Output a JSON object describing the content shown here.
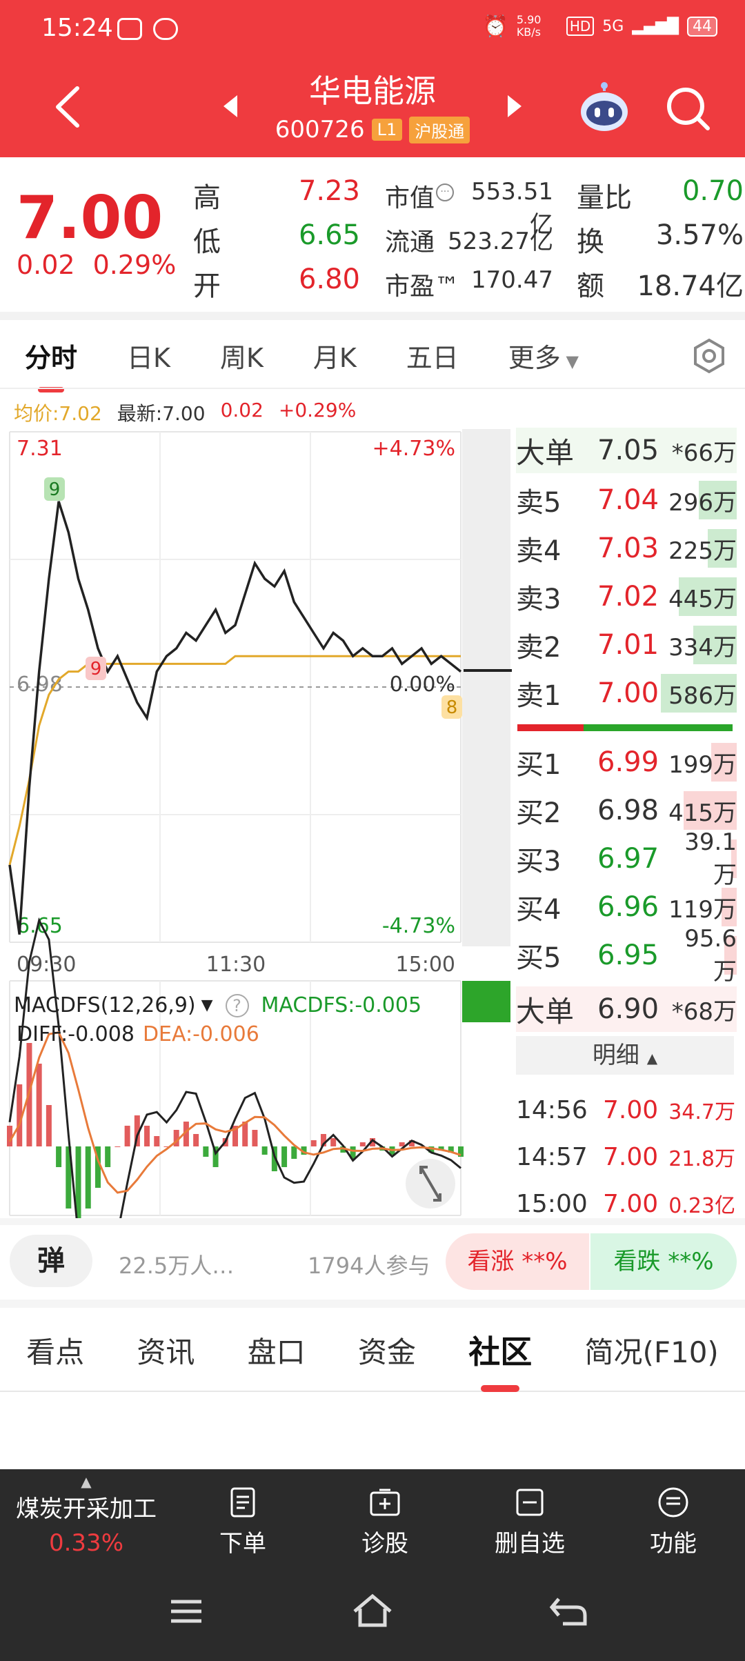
{
  "status": {
    "time": "15:24",
    "net_speed": "5.90 KB/s",
    "hd": "HD",
    "signal": "5G",
    "battery": "44"
  },
  "header": {
    "name": "华电能源",
    "code": "600726",
    "level": "L1",
    "connect": "沪股通"
  },
  "quote": {
    "price": "7.00",
    "change": "0.02",
    "change_pct": "0.29%",
    "high_label": "高",
    "high": "7.23",
    "low_label": "低",
    "low": "6.65",
    "open_label": "开",
    "open": "6.80",
    "mktcap_label": "市值",
    "mktcap": "553.51亿",
    "float_label": "流通",
    "float": "523.27亿",
    "pe_label": "市盈™",
    "pe": "170.47",
    "vr_label": "量比",
    "vr": "0.70",
    "turn_label": "换",
    "turn": "3.57%",
    "amount_label": "额",
    "amount": "18.74亿"
  },
  "tabs": [
    "分时",
    "日K",
    "周K",
    "月K",
    "五日",
    "更多"
  ],
  "summary": {
    "avg": "均价:7.02",
    "latest": "最新:7.00",
    "chg": "0.02",
    "pct": "+0.29%"
  },
  "chart_data": {
    "type": "line",
    "x_ticks": [
      "09:30",
      "11:30",
      "15:00"
    ],
    "y_top": "7.31",
    "y_bottom": "6.65",
    "y_ref": "6.98",
    "pct_top": "+4.73%",
    "pct_mid": "0.00%",
    "pct_bottom": "-4.73%",
    "ylim": [
      6.65,
      7.31
    ],
    "badges": [
      "9",
      "9",
      "8"
    ],
    "price": [
      6.75,
      6.66,
      6.85,
      7.0,
      7.12,
      7.22,
      7.18,
      7.12,
      7.08,
      7.03,
      7.0,
      7.02,
      6.99,
      6.96,
      6.94,
      7.0,
      7.02,
      7.03,
      7.05,
      7.04,
      7.06,
      7.08,
      7.05,
      7.06,
      7.1,
      7.14,
      7.12,
      7.11,
      7.13,
      7.09,
      7.07,
      7.05,
      7.03,
      7.05,
      7.04,
      7.02,
      7.03,
      7.02,
      7.02,
      7.03,
      7.01,
      7.02,
      7.03,
      7.01,
      7.02,
      7.01,
      7.0
    ],
    "avg_line": [
      6.75,
      6.8,
      6.86,
      6.93,
      6.97,
      6.99,
      7.0,
      7.0,
      7.01,
      7.01,
      7.01,
      7.01,
      7.01,
      7.01,
      7.01,
      7.01,
      7.01,
      7.01,
      7.01,
      7.01,
      7.01,
      7.01,
      7.01,
      7.02,
      7.02,
      7.02,
      7.02,
      7.02,
      7.02,
      7.02,
      7.02,
      7.02,
      7.02,
      7.02,
      7.02,
      7.02,
      7.02,
      7.02,
      7.02,
      7.02,
      7.02,
      7.02,
      7.02,
      7.02,
      7.02,
      7.02,
      7.02
    ]
  },
  "macd": {
    "title": "MACDFS(12,26,9)",
    "value": "MACDFS:-0.005",
    "diff": "DIFF:-0.008",
    "dea": "DEA:-0.006",
    "hist": [
      0.01,
      0.03,
      0.05,
      0.04,
      0.02,
      -0.01,
      -0.03,
      -0.04,
      -0.03,
      -0.02,
      -0.01,
      0.0,
      0.01,
      0.015,
      0.01,
      0.005,
      0.0,
      0.008,
      0.012,
      0.006,
      -0.005,
      -0.01,
      0.004,
      0.01,
      0.012,
      0.008,
      -0.004,
      -0.012,
      -0.01,
      -0.006,
      -0.004,
      0.003,
      0.006,
      0.004,
      -0.003,
      -0.006,
      0.002,
      0.004,
      -0.002,
      -0.004,
      0.002,
      0.003,
      -0.001,
      -0.003,
      -0.002,
      -0.003,
      -0.005
    ]
  },
  "orderbook": {
    "big_top_label": "大单",
    "big_top_price": "7.05",
    "big_top_vol": "*66万",
    "asks": [
      {
        "label": "卖5",
        "price": "7.04",
        "vol": "296万",
        "bar": 0.5
      },
      {
        "label": "卖4",
        "price": "7.03",
        "vol": "225万",
        "bar": 0.38
      },
      {
        "label": "卖3",
        "price": "7.02",
        "vol": "445万",
        "bar": 0.76
      },
      {
        "label": "卖2",
        "price": "7.01",
        "vol": "334万",
        "bar": 0.57
      },
      {
        "label": "卖1",
        "price": "7.00",
        "vol": "586万",
        "bar": 1.0
      }
    ],
    "bids": [
      {
        "label": "买1",
        "price": "6.99",
        "vol": "199万",
        "bar": 0.34
      },
      {
        "label": "买2",
        "price": "6.98",
        "vol": "415万",
        "bar": 0.7
      },
      {
        "label": "买3",
        "price": "6.97",
        "vol": "39.1万",
        "bar": 0.07
      },
      {
        "label": "买4",
        "price": "6.96",
        "vol": "119万",
        "bar": 0.2
      },
      {
        "label": "买5",
        "price": "6.95",
        "vol": "95.6万",
        "bar": 0.16
      }
    ],
    "big_bottom_label": "大单",
    "big_bottom_price": "6.90",
    "big_bottom_vol": "*68万",
    "detail_label": "明细",
    "trades": [
      {
        "time": "14:56",
        "price": "7.00",
        "vol": "34.7万"
      },
      {
        "time": "14:57",
        "price": "7.00",
        "vol": "21.8万"
      },
      {
        "time": "15:00",
        "price": "7.00",
        "vol": "0.23亿"
      }
    ]
  },
  "social": {
    "dan": "弹",
    "watchers": "22.5万人…",
    "participants": "1794人参与",
    "up": "看涨 **%",
    "down": "看跌 **%"
  },
  "info_tabs": [
    "看点",
    "资讯",
    "盘口",
    "资金",
    "社区",
    "简况(F10)"
  ],
  "toolbar": {
    "sector": "煤炭开采加工",
    "sector_pct": "0.33%",
    "order": "下单",
    "diagnose": "诊股",
    "remove": "删自选",
    "func": "功能"
  },
  "colors": {
    "red": "#e3242b",
    "green": "#1a9a2a",
    "header": "#ef3b3f",
    "avg": "#e2a82a"
  }
}
